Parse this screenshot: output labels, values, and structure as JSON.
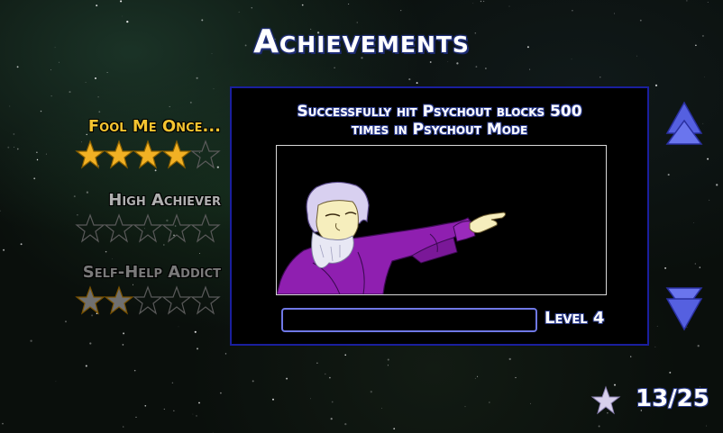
{
  "screen": {
    "title": "Achievements"
  },
  "achievements": [
    {
      "name": "Fool Me Once...",
      "stars_earned": 4,
      "stars_total": 5,
      "color": "#f4c430",
      "star_color": "#f2b124",
      "selected": true
    },
    {
      "name": "High Achiever",
      "stars_earned": 0,
      "stars_total": 5,
      "color": "#b0b0b0",
      "star_color": "#9a9a9a",
      "selected": false
    },
    {
      "name": "Self-Help Addict",
      "stars_earned": 2,
      "stars_total": 5,
      "color": "#7a7a7a",
      "star_color": "#707070",
      "selected": false
    }
  ],
  "detail": {
    "description_line1": "Successfully hit Psychout blocks 500",
    "description_line2": "times in Psychout Mode",
    "image_icon": "wizard-casting-icon",
    "progress_fraction": 0.0,
    "level_label": "Level 4"
  },
  "navigation": {
    "up_icon": "triangle-up-icon",
    "down_icon": "triangle-down-icon"
  },
  "summary": {
    "count_text": "13/25",
    "icon": "star-icon"
  },
  "colors": {
    "panel_border": "#1a1f9e",
    "arrow": "#5560e0",
    "progress_border": "#6f78e6",
    "robe": "#8f1fb0"
  }
}
